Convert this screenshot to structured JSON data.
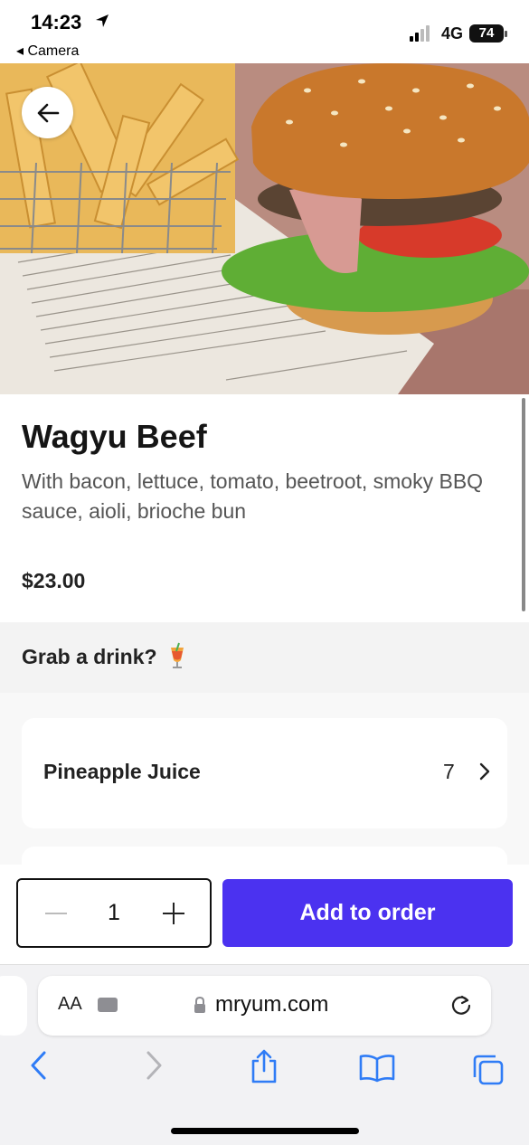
{
  "status_bar": {
    "time": "14:23",
    "network": "4G",
    "battery": "74",
    "back_app": "◂ Camera"
  },
  "item": {
    "title": "Wagyu Beef",
    "description": "With bacon, lettuce, tomato, beetroot, smoky BBQ sauce, aioli, brioche bun",
    "price": "$23.00"
  },
  "drinks": {
    "heading": "Grab a drink?",
    "items": [
      {
        "name": "Pineapple Juice",
        "price": "7"
      }
    ]
  },
  "order": {
    "quantity": "1",
    "add_label": "Add to order"
  },
  "browser": {
    "aa_label": "AA",
    "domain": "mryum.com"
  },
  "colors": {
    "accent": "#4b32f0",
    "safari_blue": "#2f7cf6"
  }
}
